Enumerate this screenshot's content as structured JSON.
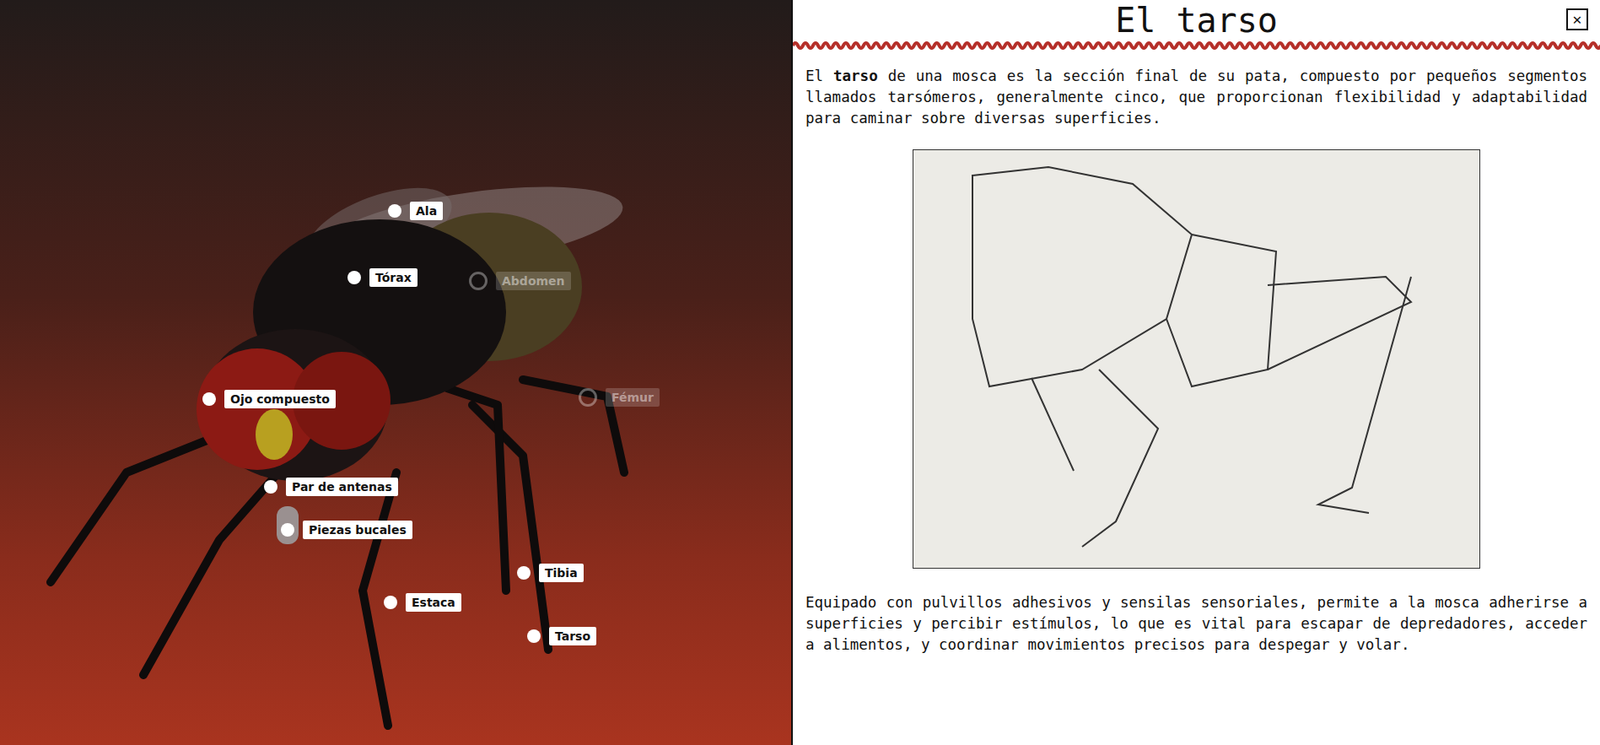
{
  "fly_labels": [
    {
      "label": "Ala",
      "dimmed": false
    },
    {
      "label": "Tórax",
      "dimmed": false
    },
    {
      "label": "Abdomen",
      "dimmed": true
    },
    {
      "label": "Ojo compuesto",
      "dimmed": false
    },
    {
      "label": "Fémur",
      "dimmed": true
    },
    {
      "label": "Par de antenas",
      "dimmed": false
    },
    {
      "label": "Piezas bucales",
      "dimmed": false
    },
    {
      "label": "Tibia",
      "dimmed": false
    },
    {
      "label": "Estaca",
      "dimmed": false
    },
    {
      "label": "Tarso",
      "dimmed": false
    }
  ],
  "panel": {
    "title": "El tarso",
    "close": "✕",
    "intro": [
      {
        "text": "El ",
        "bold": false
      },
      {
        "text": "tarso",
        "bold": true
      },
      {
        "text": " de una mosca es la sección final de su pata, compuesto por pequeños segmentos llamados tarsómeros, generalmente cinco, que proporcionan flexibilidad y adaptabilidad para caminar sobre diversas superficies.",
        "bold": false
      }
    ],
    "body": "Equipado con pulvillos adhesivos y sensilas sensoriales, permite a la mosca adherirse a superficies y percibir estímulos, lo que es vital para escapar de depredadores, acceder a alimentos, y coordinar movimientos precisos para despegar y volar."
  }
}
